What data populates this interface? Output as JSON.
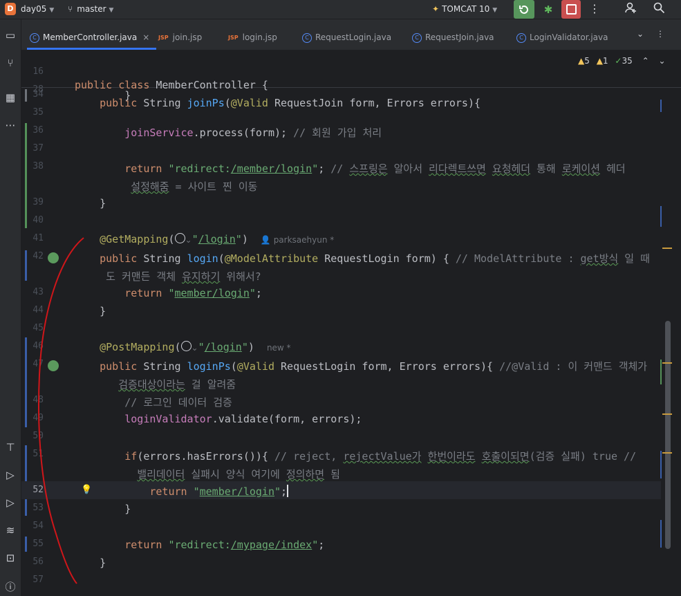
{
  "topbar": {
    "project_badge": "D",
    "project_name": "day05",
    "branch": "master",
    "run_config": "TOMCAT 10",
    "icons": [
      "run-icon",
      "debug-icon",
      "stop-icon",
      "more-icon",
      "add-user-icon",
      "search-icon"
    ]
  },
  "left_toolbar": {
    "icons": [
      "project-folder-icon",
      "commit-icon",
      "structure-icon",
      "more-icon",
      "endpoints-icon",
      "services-icon",
      "run-icon",
      "layers-icon",
      "terminal-icon",
      "problems-icon"
    ]
  },
  "tabs": [
    {
      "label": "MemberController.java",
      "type": "java",
      "active": true
    },
    {
      "label": "join.jsp",
      "type": "jsp"
    },
    {
      "label": "login.jsp",
      "type": "jsp"
    },
    {
      "label": "RequestLogin.java",
      "type": "java"
    },
    {
      "label": "RequestJoin.java",
      "type": "java"
    },
    {
      "label": "LoginValidator.java",
      "type": "java"
    }
  ],
  "tab_close_glyph": "×",
  "inspections": {
    "warnings": "5",
    "weak_warnings": "1",
    "ok": "35"
  },
  "sticky_lines": [
    {
      "num": "16",
      "text": "public class MemberController {"
    },
    {
      "num": "28",
      "text": "    public String joinPs(@Valid RequestJoin form, Errors errors){"
    }
  ],
  "lines": [
    {
      "num": "34",
      "text": "        }"
    },
    {
      "num": "35",
      "text": ""
    },
    {
      "num": "36",
      "text": "        joinService.process(form); // 회원 가입 처리"
    },
    {
      "num": "37",
      "text": ""
    },
    {
      "num": "38",
      "text": "        return \"redirect:/member/login\"; // 스프링은 알아서 리다렉트쓰면 요청헤더 통해 로케이션 헤더"
    },
    {
      "num": "",
      "text": "         설정해줌 = 사이트 찐 이동"
    },
    {
      "num": "39",
      "text": "    }"
    },
    {
      "num": "40",
      "text": ""
    },
    {
      "num": "41",
      "text": "    @GetMapping(\"/login\")"
    },
    {
      "num": "42",
      "text": "    public String login(@ModelAttribute RequestLogin form) { // ModelAttribute : get방식 일 때"
    },
    {
      "num": "",
      "text": "     도 커맨든 객체 유지하기 위해서?"
    },
    {
      "num": "43",
      "text": "        return \"member/login\";"
    },
    {
      "num": "44",
      "text": "    }"
    },
    {
      "num": "45",
      "text": ""
    },
    {
      "num": "46",
      "text": "    @PostMapping(\"/login\")"
    },
    {
      "num": "47",
      "text": "    public String loginPs(@Valid RequestLogin form, Errors errors){ //@Valid : 이 커맨드 객체가"
    },
    {
      "num": "",
      "text": "       검증대상이라는 걸 알려줌"
    },
    {
      "num": "48",
      "text": "        // 로그인 데이터 검증"
    },
    {
      "num": "49",
      "text": "        loginValidator.validate(form, errors);"
    },
    {
      "num": "50",
      "text": ""
    },
    {
      "num": "51",
      "text": "        if(errors.hasErrors()){ // reject, rejectValue가 한번이라도 호출이되면(검증 실패) true //"
    },
    {
      "num": "",
      "text": "          밸리데이터 실패시 양식 여기에 정의하면 됨"
    },
    {
      "num": "52",
      "text": "            return \"member/login\";"
    },
    {
      "num": "53",
      "text": "        }"
    },
    {
      "num": "54",
      "text": ""
    },
    {
      "num": "55",
      "text": "        return \"redirect:/mypage/index\";"
    },
    {
      "num": "56",
      "text": "    }"
    },
    {
      "num": "57",
      "text": ""
    }
  ],
  "inlay_hints": {
    "line41_author": "parksaehyun *",
    "line46_author": "new *"
  },
  "colors": {
    "accent": "#3574f0",
    "keyword": "#cf8e6d",
    "annotation": "#b3ae60",
    "function": "#56a8f5",
    "string": "#6aab73",
    "comment": "#7a7e85",
    "annotation_stroke": "#d0161a"
  }
}
